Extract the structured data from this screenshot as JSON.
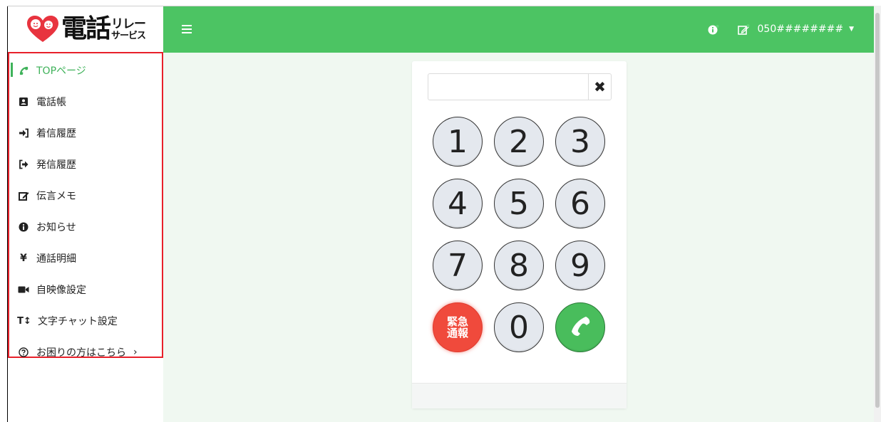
{
  "logo": {
    "main": "電話",
    "sub_top": "リレー",
    "sub_bottom": "サービス"
  },
  "sidebar": {
    "items": [
      {
        "label": "TOPページ",
        "icon": "phone-icon"
      },
      {
        "label": "電話帳",
        "icon": "address-book-icon"
      },
      {
        "label": "着信履歴",
        "icon": "incoming-arrow-icon"
      },
      {
        "label": "発信履歴",
        "icon": "outgoing-arrow-icon"
      },
      {
        "label": "伝言メモ",
        "icon": "edit-note-icon"
      },
      {
        "label": "お知らせ",
        "icon": "info-icon"
      },
      {
        "label": "通話明細",
        "icon": "yen-icon"
      },
      {
        "label": "自映像設定",
        "icon": "video-camera-icon"
      },
      {
        "label": "文字チャット設定",
        "icon": "text-size-icon"
      },
      {
        "label": "お困りの方はこちら",
        "icon": "question-circle-icon"
      }
    ],
    "active_index": 0
  },
  "header": {
    "phone_number": "050########",
    "caret": "▼"
  },
  "dialer": {
    "input_value": "",
    "clear_symbol": "✖",
    "keys": [
      "1",
      "2",
      "3",
      "4",
      "5",
      "6",
      "7",
      "8",
      "9"
    ],
    "zero": "0",
    "emergency_line1": "緊急",
    "emergency_line2": "通報"
  },
  "colors": {
    "accent_green": "#4cc463",
    "emergency_red": "#f04a3c",
    "highlight_border": "#e8202a"
  }
}
